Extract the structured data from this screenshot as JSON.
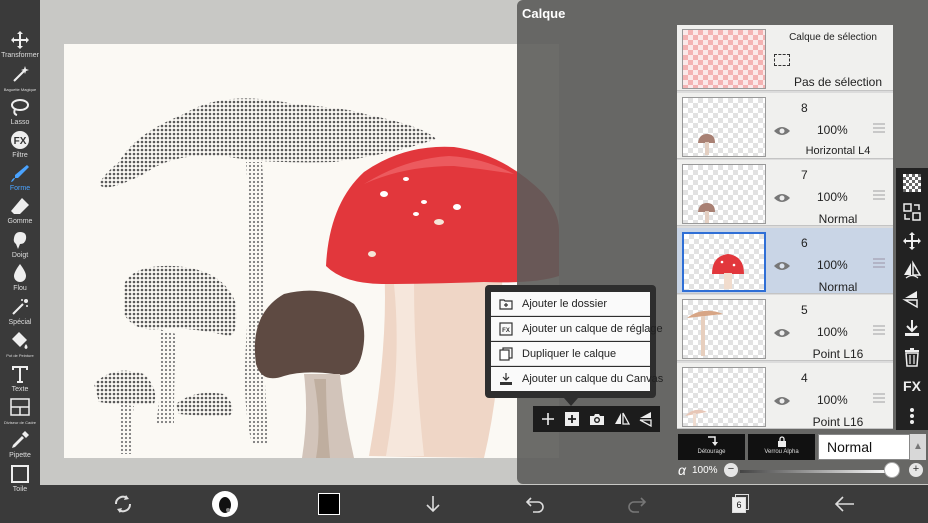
{
  "left_toolbar": {
    "tools": [
      {
        "label": "Transformer",
        "icon": "move-icon"
      },
      {
        "label": "Baguette Magique",
        "icon": "magic-wand-icon"
      },
      {
        "label": "Lasso",
        "icon": "lasso-icon"
      },
      {
        "label": "Filtre",
        "icon": "fx-icon"
      },
      {
        "label": "Forme",
        "icon": "brush-icon",
        "active": true
      },
      {
        "label": "Gomme",
        "icon": "eraser-icon"
      },
      {
        "label": "Doigt",
        "icon": "smudge-icon"
      },
      {
        "label": "Flou",
        "icon": "blur-drop-icon"
      },
      {
        "label": "Spécial",
        "icon": "special-brush-icon"
      },
      {
        "label": "Pot de Peinture",
        "icon": "paint-bucket-icon"
      },
      {
        "label": "Texte",
        "icon": "text-icon"
      },
      {
        "label": "Diviseur de Cadre",
        "icon": "frame-divider-icon"
      },
      {
        "label": "Pipette",
        "icon": "eyedropper-icon"
      },
      {
        "label": "Toile",
        "icon": "canvas-icon"
      }
    ]
  },
  "panel": {
    "title": "Calque"
  },
  "selection_layer": {
    "title": "Calque de sélection",
    "status": "Pas de sélection"
  },
  "layers": [
    {
      "number": "8",
      "opacity": "100%",
      "blend": "Horizontal L4",
      "thumb": "brown-mushroom-small"
    },
    {
      "number": "7",
      "opacity": "100%",
      "blend": "Normal",
      "thumb": "brown-mushroom-small"
    },
    {
      "number": "6",
      "opacity": "100%",
      "blend": "Normal",
      "thumb": "red-mushroom",
      "selected": true
    },
    {
      "number": "5",
      "opacity": "100%",
      "blend": "Point L16",
      "thumb": "tan-mushroom"
    },
    {
      "number": "4",
      "opacity": "100%",
      "blend": "Point L16",
      "thumb": "pale-mushroom"
    }
  ],
  "add_menu": {
    "items": [
      {
        "label": "Ajouter le dossier",
        "icon": "folder-add-icon"
      },
      {
        "label": "Ajouter un calque de réglage",
        "icon": "fx-layer-icon"
      },
      {
        "label": "Dupliquer le calque",
        "icon": "duplicate-icon"
      },
      {
        "label": "Ajouter un calque du Canvas",
        "icon": "canvas-import-icon"
      }
    ]
  },
  "layer_controls": {
    "clipping_label": "Détourage",
    "alpha_lock_label": "Verrou Alpha",
    "blend_mode": "Normal",
    "alpha_symbol": "α",
    "opacity_value": "100%",
    "opacity_fraction": 1.0
  },
  "right_strip": {
    "fx_label": "FX"
  },
  "bottom_bar": {
    "layer_count": "6"
  },
  "colors": {
    "accent_blue": "#2f6fd6",
    "active_tool": "#4aa3ff",
    "mushroom_red": "#e2373c"
  }
}
